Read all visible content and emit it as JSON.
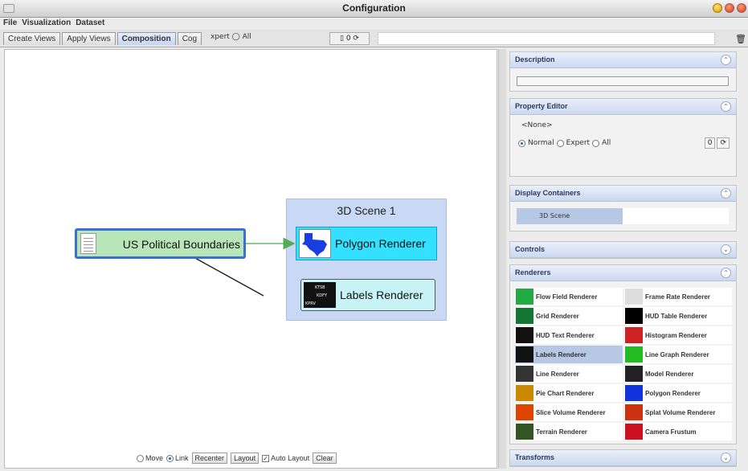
{
  "window": {
    "title": "Configuration"
  },
  "menu": [
    "File",
    "Visualization",
    "Dataset"
  ],
  "tabs": [
    {
      "label": "Create Views",
      "active": false
    },
    {
      "label": "Apply Views",
      "active": false
    },
    {
      "label": "Composition",
      "active": true
    },
    {
      "label": "Cog",
      "active": false
    }
  ],
  "tab_overlay_text": "xpert ◯ All",
  "toolbar_widget_text": "▯ 0 ⟳",
  "canvas": {
    "scene_title": "3D Scene 1",
    "source_node": "US Political Boundaries",
    "polygon_node": "Polygon Renderer",
    "labels_node": "Labels Renderer",
    "labels_icon_text": [
      "KTSB",
      "KDFY",
      "KPRV"
    ]
  },
  "bottom": {
    "move": "Move",
    "link": "Link",
    "recenter": "Recenter",
    "layout": "Layout",
    "auto_layout": "Auto Layout",
    "clear": "Clear"
  },
  "sections": {
    "description": "Description",
    "property_editor": "Property Editor",
    "pe_none": "<None>",
    "pe_normal": "Normal",
    "pe_expert": "Expert",
    "pe_all": "All",
    "pe_value": "0",
    "display_containers": "Display Containers",
    "dc_item": "3D Scene",
    "controls": "Controls",
    "renderers": "Renderers",
    "transforms": "Transforms"
  },
  "renderers": [
    {
      "label": "Flow Field Renderer",
      "icon": "flow-field-icon",
      "color": "#2a4"
    },
    {
      "label": "Frame Rate Renderer",
      "icon": "frame-rate-icon",
      "color": "#ddd"
    },
    {
      "label": "Grid Renderer",
      "icon": "grid-icon",
      "color": "#173"
    },
    {
      "label": "HUD Table Renderer",
      "icon": "hud-table-icon",
      "color": "#000"
    },
    {
      "label": "HUD Text Renderer",
      "icon": "hud-text-icon",
      "color": "#111"
    },
    {
      "label": "Histogram Renderer",
      "icon": "histogram-icon",
      "color": "#c22"
    },
    {
      "label": "Labels Renderer",
      "icon": "labels-icon",
      "color": "#111",
      "selected": true
    },
    {
      "label": "Line Graph Renderer",
      "icon": "line-graph-icon",
      "color": "#2b2"
    },
    {
      "label": "Line Renderer",
      "icon": "line-icon",
      "color": "#333"
    },
    {
      "label": "Model Renderer",
      "icon": "model-icon",
      "color": "#222"
    },
    {
      "label": "Pie Chart Renderer",
      "icon": "pie-chart-icon",
      "color": "#c80"
    },
    {
      "label": "Polygon Renderer",
      "icon": "polygon-icon",
      "color": "#13d"
    },
    {
      "label": "Slice Volume Renderer",
      "icon": "slice-volume-icon",
      "color": "#d40"
    },
    {
      "label": "Splat Volume Renderer",
      "icon": "splat-volume-icon",
      "color": "#c31"
    },
    {
      "label": "Terrain Renderer",
      "icon": "terrain-icon",
      "color": "#352"
    },
    {
      "label": "Camera Frustum",
      "icon": "camera-frustum-icon",
      "color": "#c12"
    }
  ]
}
